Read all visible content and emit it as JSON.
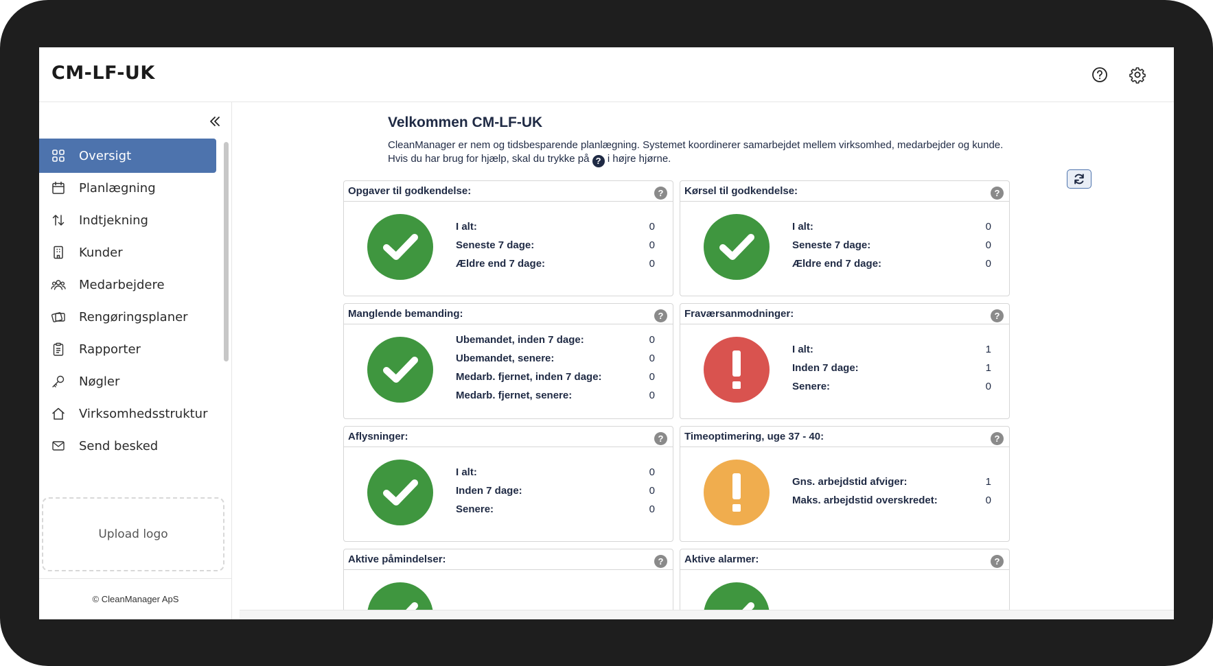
{
  "app": {
    "title": "CM-LF-UK"
  },
  "header": {
    "help_icon": "question-circle-icon",
    "settings_icon": "gear-icon"
  },
  "sidebar": {
    "collapse_icon": "double-chevron-left-icon",
    "items": [
      {
        "label": "Oversigt",
        "icon": "grid-icon",
        "active": true
      },
      {
        "label": "Planlægning",
        "icon": "calendar-icon"
      },
      {
        "label": "Indtjekning",
        "icon": "arrows-up-down-icon"
      },
      {
        "label": "Kunder",
        "icon": "building-icon"
      },
      {
        "label": "Medarbejdere",
        "icon": "users-icon"
      },
      {
        "label": "Rengøringsplaner",
        "icon": "cards-icon"
      },
      {
        "label": "Rapporter",
        "icon": "clipboard-icon"
      },
      {
        "label": "Nøgler",
        "icon": "key-icon"
      },
      {
        "label": "Virksomhedsstruktur",
        "icon": "house-icon"
      },
      {
        "label": "Send besked",
        "icon": "envelope-icon"
      }
    ],
    "upload_logo": "Upload logo",
    "footer": "© CleanManager ApS"
  },
  "main": {
    "title": "Velkommen CM-LF-UK",
    "intro_line1": "CleanManager er nem og tidsbesparende planlægning. Systemet koordinerer samarbejdet mellem virksomhed, medarbejder og kunde.",
    "intro_line2_before": "Hvis du har brug for hjælp, skal du trykke på",
    "intro_line2_after": "i højre hjørne.",
    "intro_icon_glyph": "?",
    "refresh_icon": "refresh-icon",
    "help_glyph": "?",
    "cards": [
      {
        "title": "Opgaver til godkendelse:",
        "status": "ok",
        "rows": [
          {
            "label": "I alt:",
            "value": "0"
          },
          {
            "label": "Seneste 7 dage:",
            "value": "0"
          },
          {
            "label": "Ældre end 7 dage:",
            "value": "0"
          }
        ]
      },
      {
        "title": "Kørsel til godkendelse:",
        "status": "ok",
        "rows": [
          {
            "label": "I alt:",
            "value": "0"
          },
          {
            "label": "Seneste 7 dage:",
            "value": "0"
          },
          {
            "label": "Ældre end 7 dage:",
            "value": "0"
          }
        ]
      },
      {
        "title": "Manglende bemanding:",
        "status": "ok",
        "rows": [
          {
            "label": "Ubemandet, inden 7 dage:",
            "value": "0"
          },
          {
            "label": "Ubemandet, senere:",
            "value": "0"
          },
          {
            "label": "Medarb. fjernet, inden 7 dage:",
            "value": "0"
          },
          {
            "label": "Medarb. fjernet, senere:",
            "value": "0"
          }
        ]
      },
      {
        "title": "Fraværsanmodninger:",
        "status": "bad",
        "rows": [
          {
            "label": "I alt:",
            "value": "1"
          },
          {
            "label": "Inden 7 dage:",
            "value": "1"
          },
          {
            "label": "Senere:",
            "value": "0"
          }
        ]
      },
      {
        "title": "Aflysninger:",
        "status": "ok",
        "rows": [
          {
            "label": "I alt:",
            "value": "0"
          },
          {
            "label": "Inden 7 dage:",
            "value": "0"
          },
          {
            "label": "Senere:",
            "value": "0"
          }
        ]
      },
      {
        "title": "Timeoptimering, uge 37 - 40:",
        "status": "warn",
        "rows": [
          {
            "label": "Gns. arbejdstid afviger:",
            "value": "1"
          },
          {
            "label": "Maks. arbejdstid overskredet:",
            "value": "0"
          }
        ]
      },
      {
        "title": "Aktive påmindelser:",
        "status": "ok",
        "rows": []
      },
      {
        "title": "Aktive alarmer:",
        "status": "ok",
        "rows": []
      }
    ]
  },
  "colors": {
    "accent": "#4d73ad",
    "ok": "#3f963f",
    "bad": "#d9534f",
    "warn": "#f0ad4e",
    "text": "#1f2a44",
    "bezel": "#1e1e1e"
  }
}
